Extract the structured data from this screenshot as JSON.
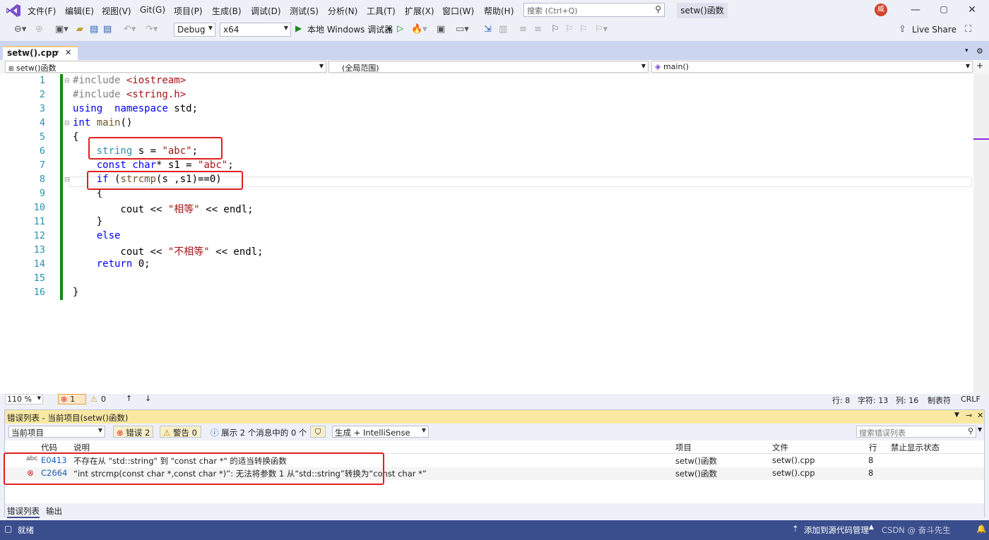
{
  "menu": [
    "文件(F)",
    "编辑(E)",
    "视图(V)",
    "Git(G)",
    "项目(P)",
    "生成(B)",
    "调试(D)",
    "测试(S)",
    "分析(N)",
    "工具(T)",
    "扩展(X)",
    "窗口(W)",
    "帮助(H)"
  ],
  "search": {
    "placeholder": "搜索 (Ctrl+Q)"
  },
  "project_badge": "setw()函数",
  "avatar_initial": "威",
  "toolbar": {
    "config": "Debug",
    "platform": "x64",
    "run_label": "本地 Windows 调试器",
    "live_share": "Live Share"
  },
  "tab": {
    "filename": "setw().cpp"
  },
  "nav": {
    "project": "setw()函数",
    "scope": "(全局范围)",
    "member": "main()"
  },
  "code_lines": [
    "1",
    "2",
    "3",
    "4",
    "5",
    "6",
    "7",
    "8",
    "9",
    "10",
    "11",
    "12",
    "13",
    "14",
    "15",
    "16"
  ],
  "editor_status": {
    "zoom": "110 %",
    "errors": "1",
    "warnings": "0",
    "line": "行: 8",
    "char": "字符: 13",
    "col": "列: 16",
    "tabs": "制表符",
    "eol": "CRLF"
  },
  "error_list": {
    "title": "错误列表 - 当前项目(setw()函数)",
    "scope": "当前项目",
    "errors_btn": "错误 2",
    "warnings_btn": "警告 0",
    "messages_btn": "展示 2 个消息中的 0 个",
    "build_filter": "生成 + IntelliSense",
    "search_placeholder": "搜索错误列表",
    "headers": {
      "code": "代码",
      "desc": "说明",
      "project": "项目",
      "file": "文件",
      "line": "行",
      "suppress": "禁止显示状态"
    },
    "rows": [
      {
        "code": "E0413",
        "desc": "不存在从 \"std::string\" 到 \"const char *\" 的适当转换函数",
        "project": "setw()函数",
        "file": "setw().cpp",
        "line": "8"
      },
      {
        "code": "C2664",
        "desc": "“int strcmp(const char *,const char *)”: 无法将参数 1 从“std::string”转换为“const char *”",
        "project": "setw()函数",
        "file": "setw().cpp",
        "line": "8"
      }
    ]
  },
  "bottom_tabs": [
    "错误列表",
    "输出"
  ],
  "statusbar": {
    "ready": "就绪",
    "source_control": "添加到源代码管理",
    "watermark": "CSDN @ 奋斗先生"
  }
}
